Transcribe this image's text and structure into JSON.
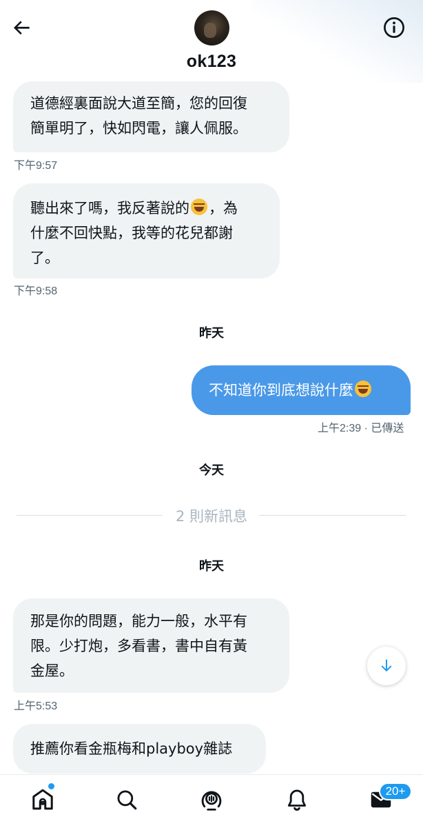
{
  "header": {
    "name": "ok123",
    "back_icon": "arrow-left-icon",
    "info_icon": "info-circle-icon"
  },
  "messages": [
    {
      "direction": "in",
      "lines": [
        "道德經裏面說大道至簡，您的回復",
        "簡單明了，快如閃電，讓人佩服。"
      ],
      "time": "下午9:57"
    },
    {
      "direction": "in",
      "parts": [
        "聽出來了嗎，我反著說的",
        "，為",
        "什麼不回快點，我等的花兒都謝",
        "了。"
      ],
      "time": "下午9:58"
    },
    {
      "direction": "out",
      "text": "不知道你到底想說什麼",
      "time": "上午2:39",
      "status": "· 已傳送"
    },
    {
      "direction": "in",
      "lines": [
        "那是你的問題，能力一般，水平有",
        "限。少打炮，多看書，書中自有黃",
        "金屋。"
      ],
      "time": "上午5:53"
    },
    {
      "direction": "in",
      "text": "推薦你看金瓶梅和playboy雜誌"
    }
  ],
  "separators": {
    "yesterday_1": "昨天",
    "today": "今天",
    "yesterday_2": "昨天",
    "new_messages": "2 則新訊息"
  },
  "tabbar": {
    "items": [
      "home-icon",
      "search-icon",
      "spaces-icon",
      "notifications-icon",
      "messages-icon"
    ],
    "messages_badge": "20+"
  },
  "colors": {
    "accent": "#1d9bf0",
    "outgoing_bubble": "#4a99e9",
    "incoming_bubble": "#eff3f4"
  }
}
